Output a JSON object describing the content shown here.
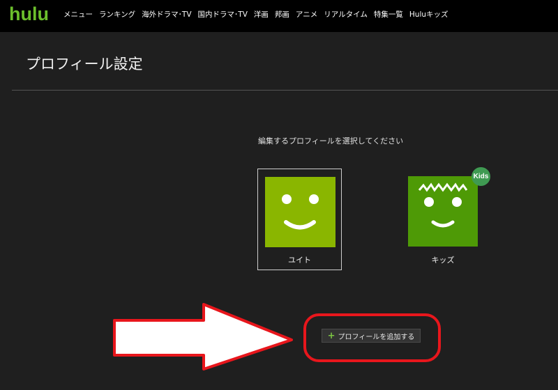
{
  "header": {
    "logo": "hulu",
    "nav": [
      "メニュー",
      "ランキング",
      "海外ドラマ･TV",
      "国内ドラマ･TV",
      "洋画",
      "邦画",
      "アニメ",
      "リアルタイム",
      "特集一覧",
      "Huluキッズ"
    ]
  },
  "page": {
    "title": "プロフィール設定",
    "instruction": "編集するプロフィールを選択してください"
  },
  "profiles": [
    {
      "name": "ユイト",
      "color": "#8ab600",
      "selected": true
    },
    {
      "name": "キッズ",
      "color": "#4e9a06",
      "badge": "Kids"
    }
  ],
  "add_button": {
    "plus": "+",
    "label": "プロフィールを追加する"
  },
  "annotation_color": "#e8161c"
}
